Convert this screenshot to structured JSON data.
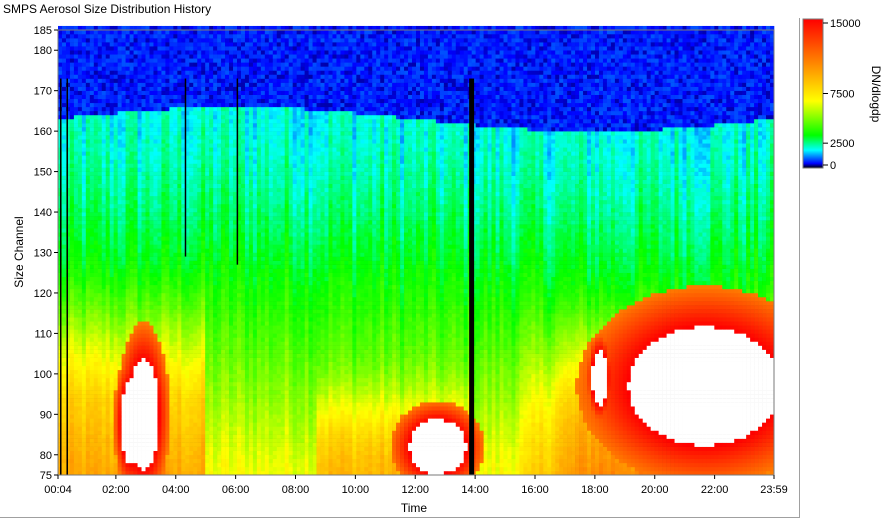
{
  "window": {
    "title": "SMPS Aerosol Size Distribution History"
  },
  "chart_data": {
    "type": "heatmap",
    "title": "",
    "xlabel": "Time",
    "ylabel": "Size Channel",
    "x_ticks": [
      "00:04",
      "02:00",
      "04:00",
      "06:00",
      "08:00",
      "10:00",
      "12:00",
      "14:00",
      "16:00",
      "18:00",
      "20:00",
      "22:00",
      "23:59"
    ],
    "x_tick_minutes": [
      4,
      120,
      240,
      360,
      480,
      600,
      720,
      840,
      960,
      1080,
      1200,
      1320,
      1439
    ],
    "xlim_minutes": [
      4,
      1439
    ],
    "y_ticks": [
      75,
      80,
      90,
      100,
      110,
      120,
      130,
      140,
      150,
      160,
      170,
      180,
      185
    ],
    "ylim": [
      75,
      185
    ],
    "grid": false,
    "colorbar": {
      "label": "DN/dlogdp",
      "ticks": [
        15000,
        7500,
        2500,
        0
      ],
      "tick_labels": [
        "15000",
        "7500",
        "2500",
        "0"
      ],
      "range": [
        0,
        15000
      ],
      "colors": [
        "#000000",
        "#0000ff",
        "#00ffff",
        "#00ff00",
        "#ffff00",
        "#ff8800",
        "#ff0000"
      ]
    },
    "features": {
      "saturated_color": "#ffffff",
      "gap_color": "#000000",
      "gaps_minutes": [
        {
          "start": 8,
          "end": 10,
          "min_channel": 75
        },
        {
          "start": 21,
          "end": 23,
          "min_channel": 75
        },
        {
          "start": 258,
          "end": 260,
          "min_channel": 129
        },
        {
          "start": 362,
          "end": 364,
          "min_channel": 127
        },
        {
          "start": 828,
          "end": 838,
          "min_channel": 75
        }
      ],
      "saturated_regions": [
        {
          "center_minute": 175,
          "center_channel": 90,
          "rx_minutes": 28,
          "ry_channels": 12
        },
        {
          "center_minute": 150,
          "center_channel": 88,
          "rx_minutes": 18,
          "ry_channels": 9
        },
        {
          "center_minute": 765,
          "center_channel": 82,
          "rx_minutes": 50,
          "ry_channels": 6
        },
        {
          "center_minute": 1090,
          "center_channel": 99,
          "rx_minutes": 14,
          "ry_channels": 6
        },
        {
          "center_minute": 1300,
          "center_channel": 97,
          "rx_minutes": 135,
          "ry_channels": 13
        }
      ]
    }
  }
}
